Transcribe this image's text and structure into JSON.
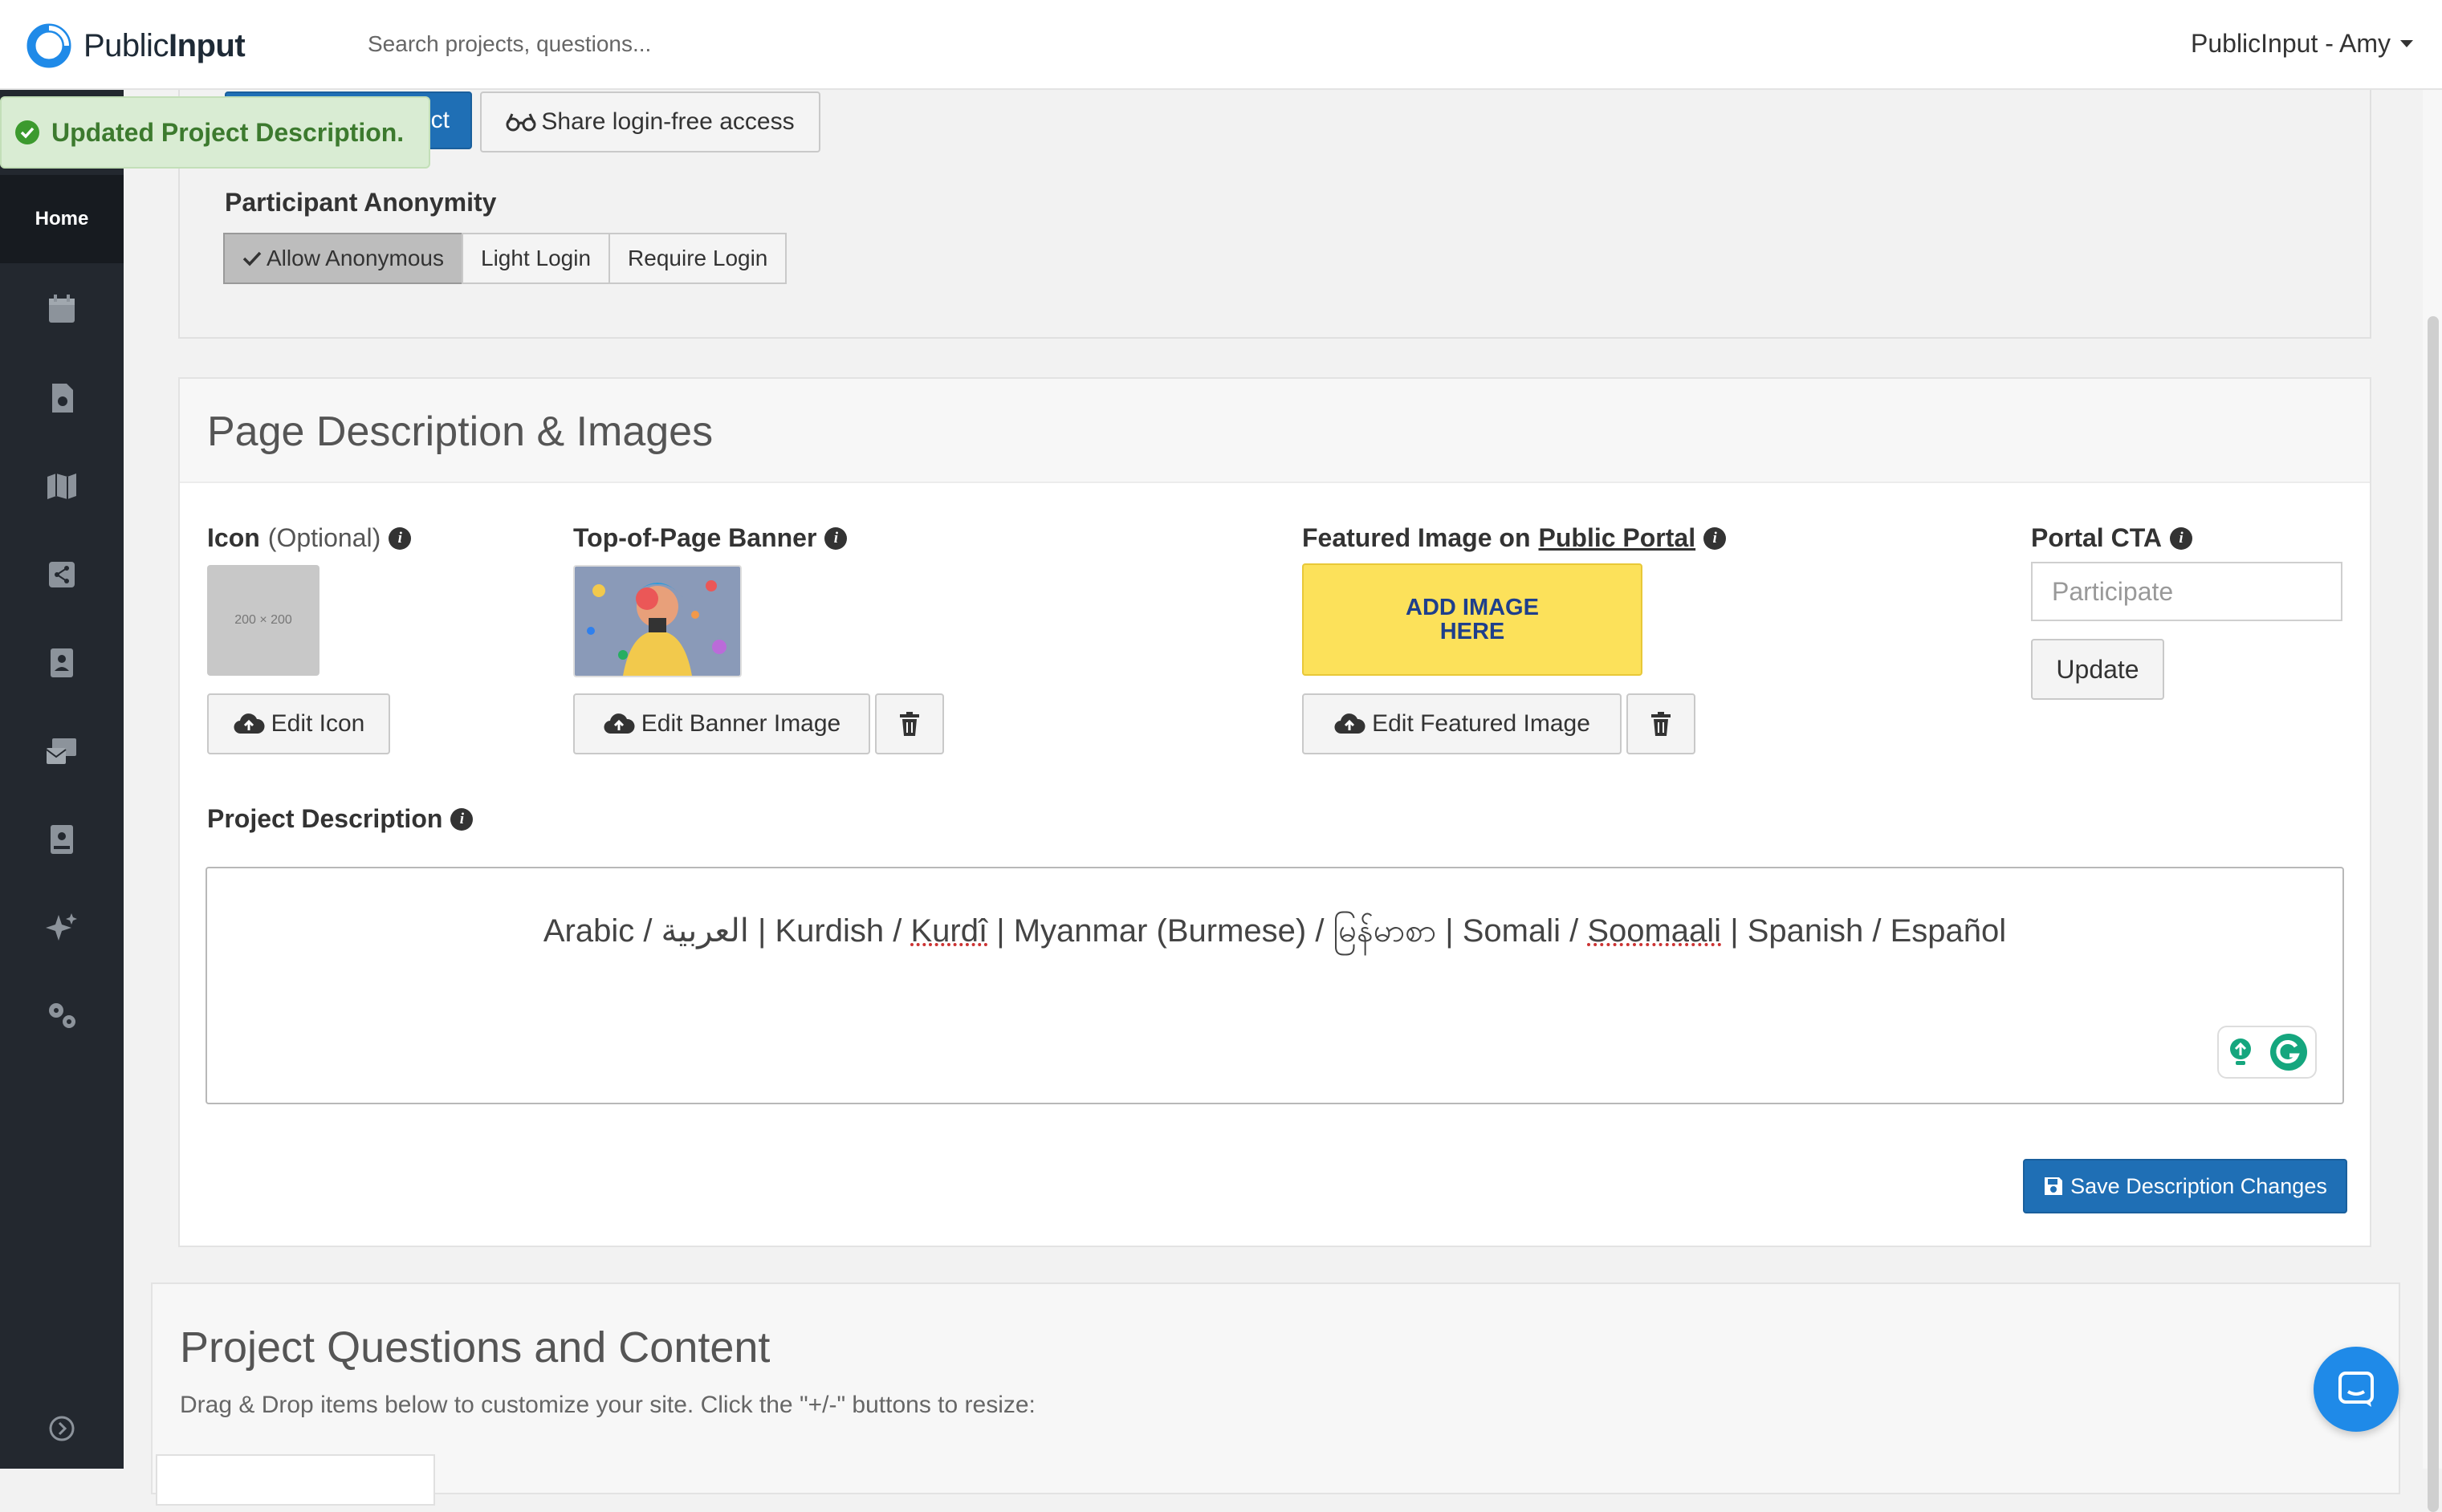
{
  "header": {
    "logo_text_public": "Public",
    "logo_text_input": "Input",
    "search_placeholder": "Search projects, questions...",
    "user_menu_label": "PublicInput - Amy"
  },
  "sidebar": {
    "home_label": "Home",
    "icons": [
      "calendar-icon",
      "document-icon",
      "map-icon",
      "share-icon",
      "contacts-icon",
      "mail-icon",
      "book-icon",
      "sparkle-icon",
      "settings-icon",
      "expand-icon"
    ]
  },
  "toast": {
    "message": "Updated Project Description."
  },
  "top_panel": {
    "blue_button_partial": "ct",
    "share_button_label": "Share login-free access",
    "anonymity_label": "Participant Anonymity",
    "anonymity_options": [
      "Allow Anonymous",
      "Light Login",
      "Require Login"
    ],
    "anonymity_selected": "Allow Anonymous"
  },
  "description_panel": {
    "title": "Page Description & Images",
    "icon_label": "Icon",
    "icon_optional": "(Optional)",
    "icon_placeholder": "200 × 200",
    "edit_icon_label": "Edit Icon",
    "banner_label": "Top-of-Page Banner",
    "edit_banner_label": "Edit Banner Image",
    "featured_label_prefix": "Featured Image on",
    "featured_label_link": "Public Portal",
    "add_image_text_line1": "ADD IMAGE",
    "add_image_text_line2": "HERE",
    "edit_featured_label": "Edit Featured Image",
    "cta_label": "Portal CTA",
    "cta_placeholder": "Participate",
    "update_label": "Update",
    "project_description_label": "Project Description",
    "editor_content": {
      "arabic": "Arabic / العربية",
      "kurdish_prefix": "Kurdish / ",
      "kurdish_word": "Kurdî",
      "myanmar": "Myanmar (Burmese) / မြန်မာစာ",
      "somali_prefix": "Somali / ",
      "somali_word": "Soomaali",
      "spanish": "Spanish / Español",
      "separator": " | "
    },
    "save_button_label": "Save Description Changes"
  },
  "questions_panel": {
    "title": "Project Questions and Content",
    "subtitle": "Drag & Drop items below to customize your site. Click the \"+/-\" buttons to resize:"
  },
  "colors": {
    "primary_blue": "#1f6fb5",
    "sidebar_dark": "#23282f",
    "toast_green": "#3c7a2e",
    "featured_yellow": "#fce15a"
  }
}
